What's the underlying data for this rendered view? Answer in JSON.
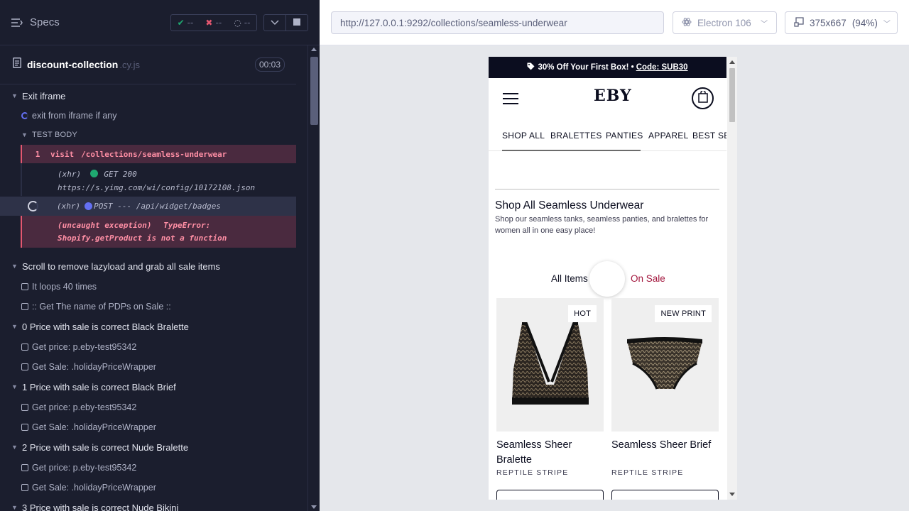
{
  "reporter": {
    "specs_label": "Specs",
    "stats": {
      "passed": "--",
      "failed": "--",
      "pending": "--"
    },
    "spec_name": "discount-collection",
    "spec_ext": ".cy.js",
    "duration": "00:03"
  },
  "suites": [
    {
      "label": "Exit iframe"
    },
    {
      "label": "Scroll to remove lazyload and grab all sale items"
    },
    {
      "label": "0 Price with sale is correct Black Bralette"
    },
    {
      "label": "1 Price with sale is correct Black Brief"
    },
    {
      "label": "2 Price with sale is correct Nude Bralette"
    },
    {
      "label": "3 Price with sale is correct Nude Bikini"
    }
  ],
  "tests": {
    "exit_iframe": "exit from iframe if any",
    "test_body": "TEST BODY",
    "loops": "It loops 40 times",
    "get_names": ":: Get The name of PDPs on Sale ::",
    "get_price": "Get price: p.eby-test95342",
    "get_sale": "Get Sale: .holidayPriceWrapper"
  },
  "commands": {
    "visit_num": "1",
    "visit_name": "visit",
    "visit_arg": "/collections/seamless-underwear",
    "xhr1_type": "(xhr)",
    "xhr1_method": "GET 200",
    "xhr1_url": "https://s.yimg.com/wi/config/10172108.json",
    "xhr2_type": "(xhr)",
    "xhr2_detail": "POST --- /api/widget/badges",
    "exc_label": "(uncaught exception)",
    "exc_type": "TypeError:",
    "exc_msg": "Shopify.getProduct is not a function"
  },
  "aut": {
    "url": "http://127.0.0.1:9292/collections/seamless-underwear",
    "browser": "Electron 106",
    "viewport": "375x667",
    "zoom": "(94%)"
  },
  "site": {
    "promo_text": "30% Off Your First Box! •",
    "promo_code": "Code: SUB30",
    "logo": "EBY",
    "nav": [
      "SHOP ALL",
      "BRALETTES",
      "PANTIES",
      "APPAREL",
      "BEST SEL"
    ],
    "title": "Shop All Seamless Underwear",
    "description": "Shop our seamless tanks, seamless panties, and bralettes for women all in one easy place!",
    "filter_all": "All Items",
    "filter_sale": "On Sale",
    "products": [
      {
        "badge": "HOT",
        "name": "Seamless Sheer Bralette",
        "print": "REPTILE STRIPE"
      },
      {
        "badge": "NEW PRINT",
        "name": "Seamless Sheer Brief",
        "print": "REPTILE STRIPE"
      }
    ]
  },
  "colors": {
    "reporter_bg": "#1b1e2e",
    "fail": "#e45770",
    "pass": "#1fa971",
    "pending": "#6470f3",
    "sale": "#a3173e"
  }
}
